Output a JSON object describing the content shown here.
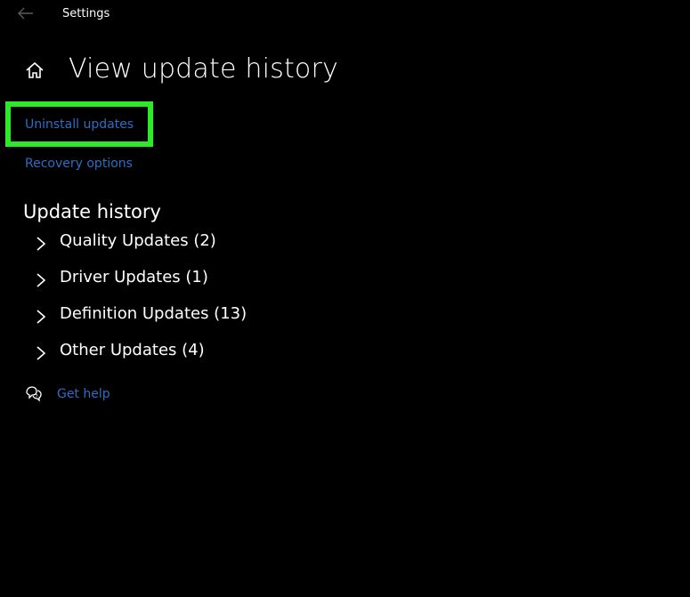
{
  "window": {
    "title": "Settings",
    "back_icon": "arrow-left-icon"
  },
  "header": {
    "home_icon": "home-icon",
    "title": "View update history"
  },
  "links": {
    "uninstall": "Uninstall updates",
    "recovery": "Recovery options"
  },
  "history": {
    "title": "Update history",
    "items": [
      {
        "label": "Quality Updates (2)"
      },
      {
        "label": "Driver Updates (1)"
      },
      {
        "label": "Definition Updates (13)"
      },
      {
        "label": "Other Updates (4)"
      }
    ]
  },
  "help": {
    "icon": "help-chat-icon",
    "label": "Get help"
  },
  "colors": {
    "background": "#000000",
    "text": "#ffffff",
    "link": "#2f6dc4",
    "highlight": "#2ee82a"
  }
}
